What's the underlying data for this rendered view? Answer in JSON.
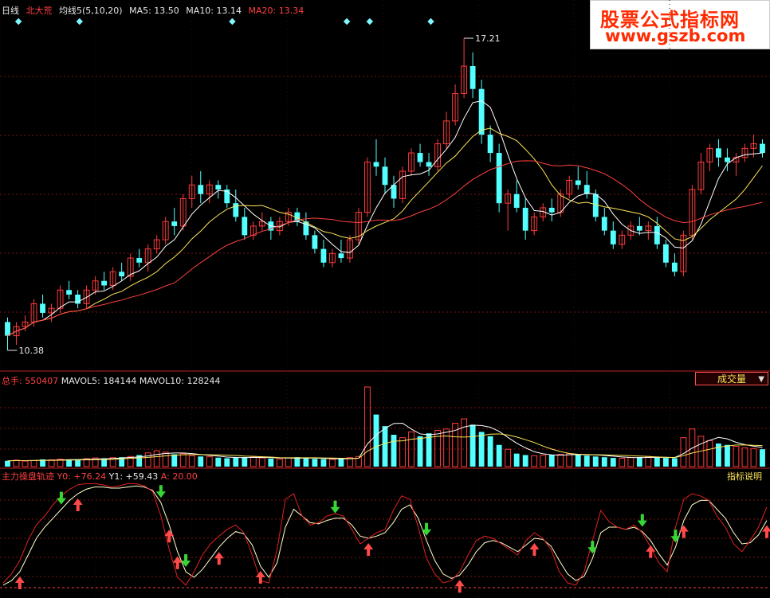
{
  "header": {
    "period": "日线",
    "stock": "北大荒",
    "ma_label": "均线5(5,10,20)",
    "ma5": "MA5: 13.50",
    "ma10": "MA10: 13.14",
    "ma20": "MA20: 13.34"
  },
  "watermark": {
    "line1": "股票公式指标网",
    "line2": "www.gszb.com"
  },
  "price_panel": {
    "high_label": "17.21",
    "low_label": "10.38"
  },
  "volume_panel": {
    "total": "总手: 550407",
    "mavol5": "MAVOL5: 184144",
    "mavol10": "MAVOL10: 128244",
    "button": "成交量",
    "button_arrow": "▼"
  },
  "indicator_panel": {
    "name": "主力操盘轨迹",
    "y0": "Y0: +76.24",
    "y1": "Y1: +59.43",
    "a": "A: 20.00",
    "help": "指标说明"
  },
  "colors": {
    "up": "#ff3b3b",
    "down": "#54ffff",
    "ma5": "#ffffff",
    "ma10": "#ffe75a",
    "ma20": "#ff4040",
    "grid": "#7a1515",
    "buy_arrow": "#ff4a4a",
    "sell_arrow": "#37d637"
  },
  "chart_data": {
    "type": "candlestick",
    "price_range": [
      10.38,
      17.21
    ],
    "candles": [
      [
        11.0,
        11.1,
        10.38,
        10.7
      ],
      [
        10.7,
        11.0,
        10.5,
        10.9
      ],
      [
        10.9,
        11.15,
        10.8,
        11.0
      ],
      [
        11.0,
        11.5,
        10.9,
        11.4
      ],
      [
        11.4,
        11.6,
        11.1,
        11.2
      ],
      [
        11.2,
        11.4,
        11.0,
        11.3
      ],
      [
        11.3,
        11.8,
        11.2,
        11.7
      ],
      [
        11.7,
        11.9,
        11.5,
        11.6
      ],
      [
        11.6,
        11.7,
        11.3,
        11.4
      ],
      [
        11.4,
        11.8,
        11.3,
        11.7
      ],
      [
        11.7,
        12.0,
        11.6,
        11.9
      ],
      [
        11.9,
        12.1,
        11.7,
        11.8
      ],
      [
        11.8,
        12.2,
        11.7,
        12.1
      ],
      [
        12.1,
        12.3,
        11.9,
        12.0
      ],
      [
        12.0,
        12.5,
        11.9,
        12.4
      ],
      [
        12.4,
        12.6,
        12.2,
        12.3
      ],
      [
        12.3,
        12.7,
        12.1,
        12.6
      ],
      [
        12.6,
        12.9,
        12.5,
        12.8
      ],
      [
        12.8,
        13.3,
        12.7,
        13.2
      ],
      [
        13.2,
        13.5,
        12.9,
        13.1
      ],
      [
        13.1,
        13.8,
        13.0,
        13.7
      ],
      [
        13.7,
        14.2,
        13.5,
        14.0
      ],
      [
        14.0,
        14.3,
        13.6,
        13.8
      ],
      [
        13.8,
        14.1,
        13.6,
        14.0
      ],
      [
        14.0,
        14.1,
        13.7,
        13.9
      ],
      [
        13.9,
        14.0,
        13.5,
        13.6
      ],
      [
        13.6,
        13.9,
        13.2,
        13.3
      ],
      [
        13.3,
        13.5,
        12.8,
        12.9
      ],
      [
        12.9,
        13.2,
        12.8,
        13.1
      ],
      [
        13.1,
        13.4,
        13.0,
        13.2
      ],
      [
        13.2,
        13.3,
        12.8,
        13.0
      ],
      [
        13.0,
        13.3,
        12.9,
        13.2
      ],
      [
        13.2,
        13.5,
        13.1,
        13.4
      ],
      [
        13.4,
        13.5,
        13.1,
        13.2
      ],
      [
        13.2,
        13.4,
        12.8,
        12.9
      ],
      [
        12.9,
        13.0,
        12.5,
        12.6
      ],
      [
        12.6,
        12.8,
        12.2,
        12.3
      ],
      [
        12.3,
        12.6,
        12.2,
        12.5
      ],
      [
        12.5,
        12.8,
        12.3,
        12.4
      ],
      [
        12.4,
        12.9,
        12.3,
        12.8
      ],
      [
        12.8,
        13.5,
        12.7,
        13.4
      ],
      [
        13.4,
        14.6,
        13.3,
        14.5
      ],
      [
        14.5,
        15.0,
        14.2,
        14.4
      ],
      [
        14.4,
        14.6,
        13.8,
        14.0
      ],
      [
        14.0,
        14.2,
        13.5,
        13.7
      ],
      [
        13.7,
        14.4,
        13.6,
        14.3
      ],
      [
        14.3,
        14.8,
        14.2,
        14.7
      ],
      [
        14.7,
        14.9,
        14.4,
        14.5
      ],
      [
        14.5,
        14.7,
        14.2,
        14.4
      ],
      [
        14.4,
        15.0,
        14.3,
        14.9
      ],
      [
        14.9,
        15.6,
        14.8,
        15.4
      ],
      [
        15.4,
        16.2,
        15.3,
        16.0
      ],
      [
        16.0,
        17.21,
        15.9,
        16.6
      ],
      [
        16.6,
        16.9,
        15.9,
        16.1
      ],
      [
        16.1,
        16.3,
        14.9,
        15.1
      ],
      [
        15.1,
        15.3,
        14.5,
        14.7
      ],
      [
        14.7,
        14.9,
        13.4,
        13.6
      ],
      [
        13.6,
        13.9,
        13.0,
        13.8
      ],
      [
        13.8,
        14.1,
        13.4,
        13.5
      ],
      [
        13.5,
        13.7,
        12.8,
        13.0
      ],
      [
        13.0,
        13.4,
        12.9,
        13.3
      ],
      [
        13.3,
        13.6,
        13.2,
        13.5
      ],
      [
        13.5,
        13.7,
        13.2,
        13.4
      ],
      [
        13.4,
        13.9,
        13.3,
        13.8
      ],
      [
        13.8,
        14.2,
        13.7,
        14.1
      ],
      [
        14.1,
        14.4,
        13.9,
        14.0
      ],
      [
        14.0,
        14.3,
        13.7,
        13.8
      ],
      [
        13.8,
        13.9,
        13.2,
        13.3
      ],
      [
        13.3,
        13.5,
        12.9,
        13.0
      ],
      [
        13.0,
        13.2,
        12.6,
        12.7
      ],
      [
        12.7,
        13.0,
        12.6,
        12.9
      ],
      [
        12.9,
        13.2,
        12.8,
        13.1
      ],
      [
        13.1,
        13.3,
        12.9,
        13.0
      ],
      [
        13.0,
        13.2,
        12.8,
        13.1
      ],
      [
        13.1,
        13.3,
        12.6,
        12.7
      ],
      [
        12.7,
        12.8,
        12.2,
        12.3
      ],
      [
        12.3,
        12.5,
        12.0,
        12.1
      ],
      [
        12.1,
        13.0,
        12.0,
        12.9
      ],
      [
        12.9,
        14.0,
        12.8,
        13.9
      ],
      [
        13.9,
        14.7,
        13.8,
        14.5
      ],
      [
        14.5,
        14.9,
        14.3,
        14.8
      ],
      [
        14.8,
        15.0,
        14.4,
        14.6
      ],
      [
        14.6,
        14.8,
        14.3,
        14.5
      ],
      [
        14.5,
        14.7,
        14.2,
        14.6
      ],
      [
        14.6,
        14.9,
        14.5,
        14.8
      ],
      [
        14.8,
        15.1,
        14.6,
        14.9
      ],
      [
        14.9,
        15.0,
        14.6,
        14.7
      ]
    ],
    "volume_range": [
      0,
      550407
    ],
    "volumes": [
      40000,
      45000,
      38000,
      42000,
      50000,
      47000,
      52000,
      48000,
      44000,
      55000,
      60000,
      58000,
      62000,
      65000,
      70000,
      80000,
      95000,
      110000,
      100000,
      85000,
      90000,
      75000,
      70000,
      68000,
      62000,
      58000,
      64000,
      66000,
      70000,
      60000,
      55000,
      52000,
      60000,
      65000,
      58000,
      54000,
      52000,
      50000,
      56000,
      62000,
      70000,
      550407,
      360000,
      280000,
      220000,
      200000,
      240000,
      210000,
      230000,
      250000,
      260000,
      300000,
      330000,
      290000,
      240000,
      210000,
      150000,
      120000,
      90000,
      80000,
      75000,
      78000,
      80000,
      85000,
      90000,
      82000,
      76000,
      70000,
      65000,
      60000,
      58000,
      62000,
      66000,
      70000,
      64000,
      60000,
      58000,
      200000,
      260000,
      210000,
      180000,
      160000,
      150000,
      140000,
      130000,
      125000,
      120000
    ],
    "mavol5": [
      40000,
      42000,
      41000,
      42000,
      44000,
      44000,
      46000,
      48000,
      49000,
      50000,
      52000,
      54000,
      56000,
      60000,
      63000,
      67000,
      74000,
      84000,
      91000,
      94000,
      94000,
      90000,
      84000,
      78000,
      73000,
      66000,
      63000,
      62000,
      64000,
      63000,
      62000,
      60000,
      59000,
      58000,
      59000,
      59000,
      57000,
      55000,
      54000,
      55000,
      58000,
      157000,
      218000,
      264000,
      298000,
      300000,
      260000,
      226000,
      220000,
      226000,
      238000,
      250000,
      274000,
      286000,
      284000,
      272000,
      244000,
      202000,
      162000,
      130000,
      103000,
      89000,
      81000,
      79000,
      82000,
      83000,
      82000,
      81000,
      77000,
      72000,
      67000,
      63000,
      62000,
      63000,
      64000,
      64000,
      63000,
      90000,
      128000,
      158000,
      182000,
      202000,
      192000,
      168000,
      152000,
      141000,
      133000
    ],
    "mavol10": [
      40000,
      41000,
      41000,
      42000,
      43000,
      43000,
      44000,
      45000,
      46000,
      47000,
      48000,
      49000,
      51000,
      54000,
      57000,
      60000,
      64000,
      69000,
      74000,
      79000,
      82000,
      83000,
      83000,
      82000,
      81000,
      79000,
      77000,
      73000,
      71000,
      68000,
      66000,
      62000,
      61000,
      61000,
      61000,
      61000,
      60000,
      59000,
      58000,
      57000,
      58000,
      107000,
      138000,
      160000,
      176000,
      178000,
      189000,
      195000,
      202000,
      209000,
      212000,
      206000,
      204000,
      207000,
      215000,
      224000,
      226000,
      219000,
      205000,
      186000,
      167000,
      142000,
      121000,
      104000,
      91000,
      85000,
      84000,
      82000,
      81000,
      79000,
      78000,
      76000,
      73000,
      70000,
      67000,
      65000,
      62000,
      76000,
      94000,
      107000,
      120000,
      134000,
      142000,
      149000,
      150000,
      147000,
      145000
    ],
    "indicator_range": [
      0,
      100
    ],
    "y0": [
      10,
      18,
      30,
      48,
      62,
      70,
      80,
      88,
      94,
      98,
      99,
      99,
      98,
      96,
      97,
      99,
      99,
      97,
      92,
      70,
      40,
      15,
      8,
      20,
      35,
      45,
      52,
      58,
      62,
      55,
      35,
      12,
      10,
      40,
      85,
      90,
      70,
      62,
      64,
      70,
      72,
      70,
      58,
      45,
      50,
      55,
      58,
      75,
      88,
      85,
      60,
      32,
      18,
      10,
      12,
      20,
      35,
      48,
      52,
      50,
      45,
      40,
      35,
      48,
      55,
      50,
      40,
      20,
      10,
      8,
      20,
      48,
      75,
      65,
      60,
      58,
      62,
      55,
      42,
      28,
      20,
      60,
      85,
      90,
      88,
      84,
      70,
      60,
      45,
      38,
      48,
      60,
      78
    ],
    "y1": [
      8,
      12,
      20,
      35,
      50,
      60,
      68,
      76,
      84,
      90,
      94,
      96,
      96,
      95,
      95,
      96,
      97,
      96,
      93,
      82,
      62,
      38,
      20,
      15,
      22,
      32,
      42,
      50,
      56,
      54,
      44,
      25,
      15,
      28,
      60,
      76,
      70,
      64,
      63,
      66,
      68,
      68,
      62,
      52,
      50,
      52,
      55,
      64,
      76,
      80,
      68,
      48,
      30,
      18,
      14,
      17,
      26,
      38,
      46,
      48,
      46,
      42,
      38,
      44,
      50,
      49,
      43,
      30,
      18,
      12,
      16,
      32,
      55,
      60,
      60,
      58,
      60,
      56,
      48,
      36,
      26,
      42,
      66,
      80,
      84,
      84,
      76,
      68,
      55,
      45,
      46,
      53,
      66
    ],
    "buy_signals": [
      2,
      9,
      20,
      21,
      26,
      31,
      44,
      55,
      64,
      78,
      82,
      92,
      96,
      103,
      112
    ],
    "sell_signals": [
      7,
      19,
      22,
      40,
      51,
      71,
      77,
      81,
      95,
      99,
      102,
      108,
      114
    ]
  }
}
